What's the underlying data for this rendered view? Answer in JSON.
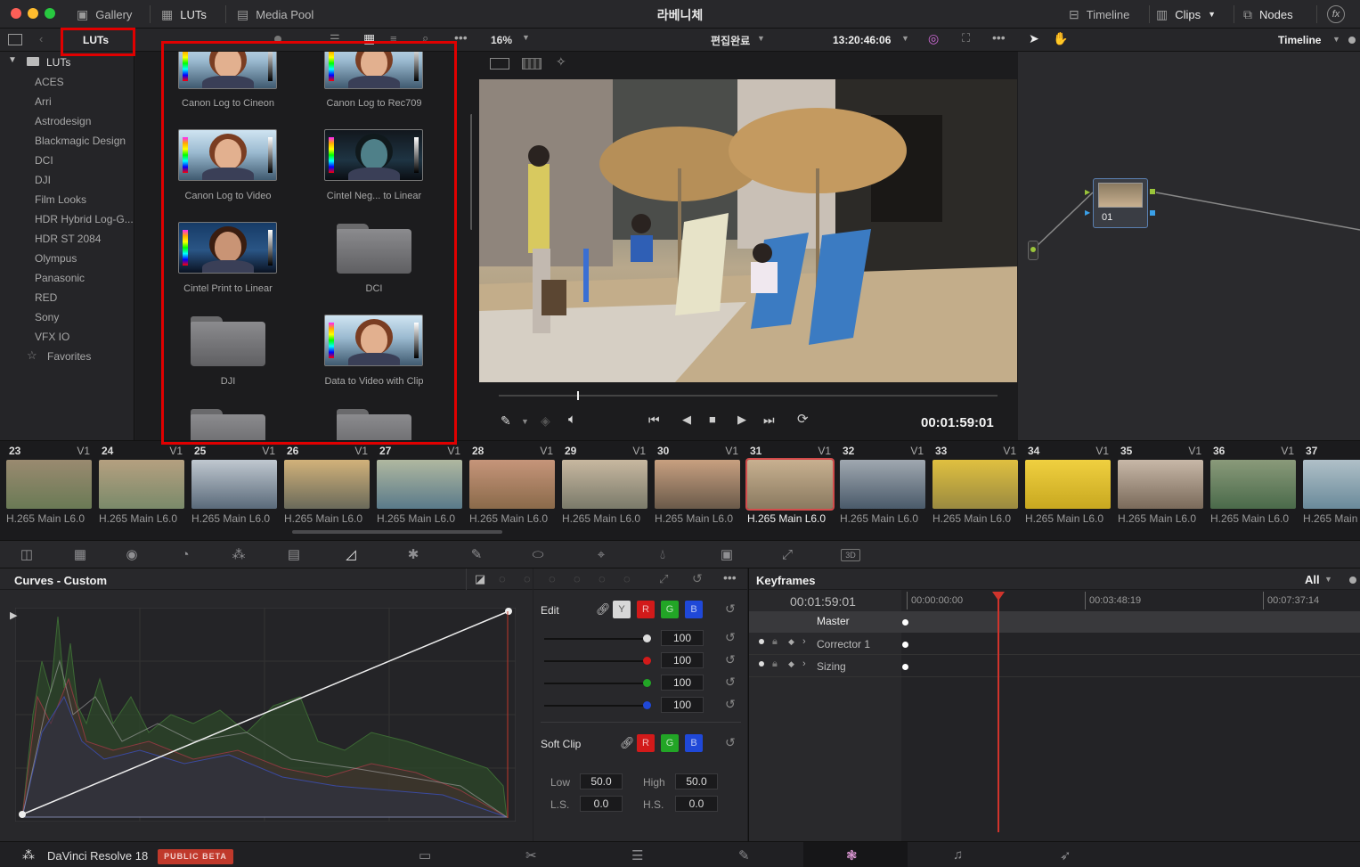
{
  "window": {
    "project_title": "라베니체"
  },
  "topbar": {
    "gallery_label": "Gallery",
    "luts_label": "LUTs",
    "media_pool_label": "Media Pool",
    "timeline_label": "Timeline",
    "clips_label": "Clips",
    "nodes_label": "Nodes",
    "fx_label": "fx"
  },
  "lut_browser": {
    "breadcrumb": "LUTs",
    "root": "LUTs",
    "folders": [
      "ACES",
      "Arri",
      "Astrodesign",
      "Blackmagic Design",
      "DCI",
      "DJI",
      "Film Looks",
      "HDR Hybrid Log-G...",
      "HDR ST 2084",
      "Olympus",
      "Panasonic",
      "RED",
      "Sony",
      "VFX IO"
    ],
    "favorites": "Favorites",
    "items": [
      {
        "caption": "Canon Log to Cineon"
      },
      {
        "caption": "Canon Log to Rec709"
      },
      {
        "caption": "Canon Log to Video"
      },
      {
        "caption": "Cintel Neg... to Linear"
      },
      {
        "caption": "Cintel Print to Linear"
      },
      {
        "caption": "DCI"
      },
      {
        "caption": "DJI"
      },
      {
        "caption": "Data to Video with Clip"
      }
    ]
  },
  "viewer": {
    "zoom": "16%",
    "clip_name": "편집완료",
    "timecode": "13:20:46:06",
    "playhead_tc": "00:01:59:01"
  },
  "node_graph": {
    "mode": "Timeline",
    "node_label": "01"
  },
  "clips": [
    {
      "num": "23",
      "track": "V1",
      "codec": "H.265 Main L6.0"
    },
    {
      "num": "24",
      "track": "V1",
      "codec": "H.265 Main L6.0"
    },
    {
      "num": "25",
      "track": "V1",
      "codec": "H.265 Main L6.0"
    },
    {
      "num": "26",
      "track": "V1",
      "codec": "H.265 Main L6.0"
    },
    {
      "num": "27",
      "track": "V1",
      "codec": "H.265 Main L6.0"
    },
    {
      "num": "28",
      "track": "V1",
      "codec": "H.265 Main L6.0"
    },
    {
      "num": "29",
      "track": "V1",
      "codec": "H.265 Main L6.0"
    },
    {
      "num": "30",
      "track": "V1",
      "codec": "H.265 Main L6.0"
    },
    {
      "num": "31",
      "track": "V1",
      "codec": "H.265 Main L6.0"
    },
    {
      "num": "32",
      "track": "V1",
      "codec": "H.265 Main L6.0"
    },
    {
      "num": "33",
      "track": "V1",
      "codec": "H.265 Main L6.0"
    },
    {
      "num": "34",
      "track": "V1",
      "codec": "H.265 Main L6.0"
    },
    {
      "num": "35",
      "track": "V1",
      "codec": "H.265 Main L6.0"
    },
    {
      "num": "36",
      "track": "V1",
      "codec": "H.265 Main L6.0"
    },
    {
      "num": "37",
      "track": "",
      "codec": "H.265 Main"
    }
  ],
  "curves": {
    "title": "Curves - Custom",
    "edit_label": "Edit",
    "channels": [
      "Y",
      "R",
      "G",
      "B"
    ],
    "values": [
      "100",
      "100",
      "100",
      "100"
    ],
    "soft_clip_label": "Soft Clip",
    "soft_channels": [
      "R",
      "G",
      "B"
    ],
    "low_label": "Low",
    "low_value": "50.0",
    "high_label": "High",
    "high_value": "50.0",
    "ls_label": "L.S.",
    "ls_value": "0.0",
    "hs_label": "H.S.",
    "hs_value": "0.0"
  },
  "keyframes": {
    "title": "Keyframes",
    "filter": "All",
    "current_tc": "00:01:59:01",
    "ruler": [
      "00:00:00:00",
      "00:03:48:19",
      "00:07:37:14"
    ],
    "tracks": [
      "Master",
      "Corrector 1",
      "Sizing"
    ]
  },
  "footer": {
    "app_name": "DaVinci Resolve 18",
    "badge": "PUBLIC BETA"
  },
  "colors": {
    "accent_red": "#e00000",
    "panel": "#28282b",
    "selected_clip": "#d24b4b"
  }
}
